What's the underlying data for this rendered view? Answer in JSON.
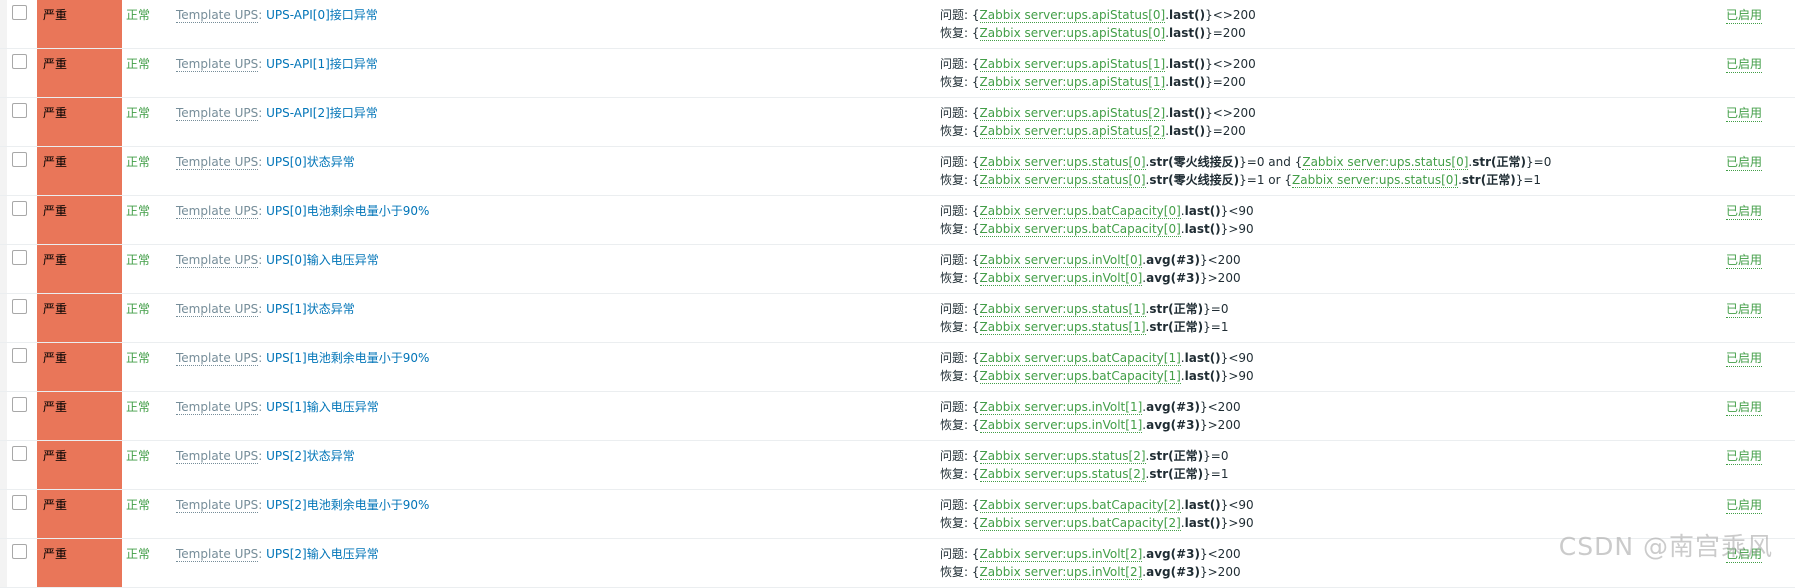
{
  "severity_label": "严重",
  "status_label": "正常",
  "enabled_label": "已启用",
  "colors": {
    "severity_bg": "#e97659",
    "status_green": "#429e47",
    "link_blue": "#0275b8",
    "template_gray": "#768d99"
  },
  "rows": [
    {
      "template": "Template UPS",
      "name": "UPS-API[0]接口异常",
      "problem": {
        "label": "问题:",
        "item": "Zabbix server:ups.apiStatus[0]",
        "fn": "last()",
        "tail": "<>200"
      },
      "recovery": {
        "label": "恢复:",
        "item": "Zabbix server:ups.apiStatus[0]",
        "fn": "last()",
        "tail": "=200"
      }
    },
    {
      "template": "Template UPS",
      "name": "UPS-API[1]接口异常",
      "problem": {
        "label": "问题:",
        "item": "Zabbix server:ups.apiStatus[1]",
        "fn": "last()",
        "tail": "<>200"
      },
      "recovery": {
        "label": "恢复:",
        "item": "Zabbix server:ups.apiStatus[1]",
        "fn": "last()",
        "tail": "=200"
      }
    },
    {
      "template": "Template UPS",
      "name": "UPS-API[2]接口异常",
      "problem": {
        "label": "问题:",
        "item": "Zabbix server:ups.apiStatus[2]",
        "fn": "last()",
        "tail": "<>200"
      },
      "recovery": {
        "label": "恢复:",
        "item": "Zabbix server:ups.apiStatus[2]",
        "fn": "last()",
        "tail": "=200"
      }
    },
    {
      "template": "Template UPS",
      "name": "UPS[0]状态异常",
      "problem": {
        "label": "问题:",
        "item": "Zabbix server:ups.status[0]",
        "fn": "str(零火线接反)",
        "tail": "=0 and ",
        "item2": "Zabbix server:ups.status[0]",
        "fn2": "str(正常)",
        "tail2": "=0"
      },
      "recovery": {
        "label": "恢复:",
        "item": "Zabbix server:ups.status[0]",
        "fn": "str(零火线接反)",
        "tail": "=1 or ",
        "item2": "Zabbix server:ups.status[0]",
        "fn2": "str(正常)",
        "tail2": "=1"
      }
    },
    {
      "template": "Template UPS",
      "name": "UPS[0]电池剩余电量小于90%",
      "problem": {
        "label": "问题:",
        "item": "Zabbix server:ups.batCapacity[0]",
        "fn": "last()",
        "tail": "<90"
      },
      "recovery": {
        "label": "恢复:",
        "item": "Zabbix server:ups.batCapacity[0]",
        "fn": "last()",
        "tail": ">90"
      }
    },
    {
      "template": "Template UPS",
      "name": "UPS[0]输入电压异常",
      "problem": {
        "label": "问题:",
        "item": "Zabbix server:ups.inVolt[0]",
        "fn": "avg(#3)",
        "tail": "<200"
      },
      "recovery": {
        "label": "恢复:",
        "item": "Zabbix server:ups.inVolt[0]",
        "fn": "avg(#3)",
        "tail": ">200"
      }
    },
    {
      "template": "Template UPS",
      "name": "UPS[1]状态异常",
      "problem": {
        "label": "问题:",
        "item": "Zabbix server:ups.status[1]",
        "fn": "str(正常)",
        "tail": "=0"
      },
      "recovery": {
        "label": "恢复:",
        "item": "Zabbix server:ups.status[1]",
        "fn": "str(正常)",
        "tail": "=1"
      }
    },
    {
      "template": "Template UPS",
      "name": "UPS[1]电池剩余电量小于90%",
      "problem": {
        "label": "问题:",
        "item": "Zabbix server:ups.batCapacity[1]",
        "fn": "last()",
        "tail": "<90"
      },
      "recovery": {
        "label": "恢复:",
        "item": "Zabbix server:ups.batCapacity[1]",
        "fn": "last()",
        "tail": ">90"
      }
    },
    {
      "template": "Template UPS",
      "name": "UPS[1]输入电压异常",
      "problem": {
        "label": "问题:",
        "item": "Zabbix server:ups.inVolt[1]",
        "fn": "avg(#3)",
        "tail": "<200"
      },
      "recovery": {
        "label": "恢复:",
        "item": "Zabbix server:ups.inVolt[1]",
        "fn": "avg(#3)",
        "tail": ">200"
      }
    },
    {
      "template": "Template UPS",
      "name": "UPS[2]状态异常",
      "problem": {
        "label": "问题:",
        "item": "Zabbix server:ups.status[2]",
        "fn": "str(正常)",
        "tail": "=0"
      },
      "recovery": {
        "label": "恢复:",
        "item": "Zabbix server:ups.status[2]",
        "fn": "str(正常)",
        "tail": "=1"
      }
    },
    {
      "template": "Template UPS",
      "name": "UPS[2]电池剩余电量小于90%",
      "problem": {
        "label": "问题:",
        "item": "Zabbix server:ups.batCapacity[2]",
        "fn": "last()",
        "tail": "<90"
      },
      "recovery": {
        "label": "恢复:",
        "item": "Zabbix server:ups.batCapacity[2]",
        "fn": "last()",
        "tail": ">90"
      }
    },
    {
      "template": "Template UPS",
      "name": "UPS[2]输入电压异常",
      "problem": {
        "label": "问题:",
        "item": "Zabbix server:ups.inVolt[2]",
        "fn": "avg(#3)",
        "tail": "<200"
      },
      "recovery": {
        "label": "恢复:",
        "item": "Zabbix server:ups.inVolt[2]",
        "fn": "avg(#3)",
        "tail": ">200"
      }
    }
  ],
  "watermark": "CSDN @南宫乘风"
}
